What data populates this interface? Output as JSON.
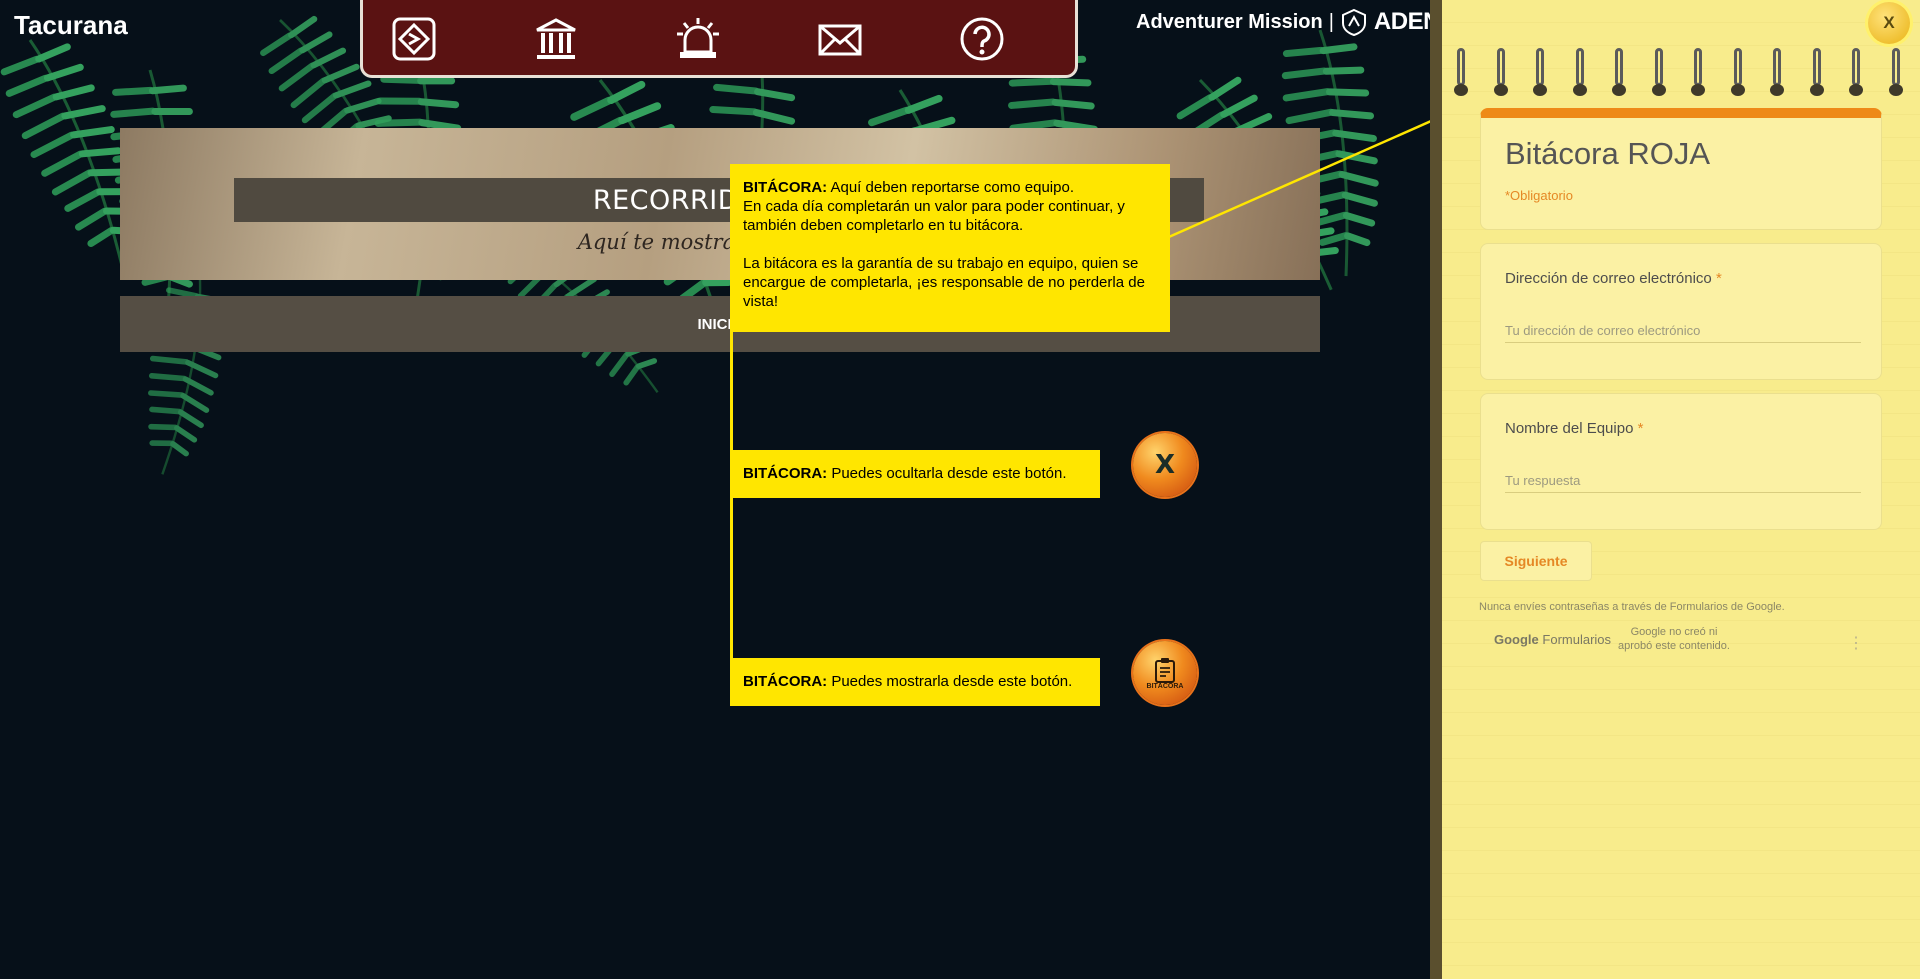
{
  "app": {
    "title": "Tacurana"
  },
  "toolbar": {
    "buttons": [
      {
        "name": "map-button",
        "icon": "map-pin-icon"
      },
      {
        "name": "museum-button",
        "icon": "museum-icon"
      },
      {
        "name": "alert-button",
        "icon": "siren-icon"
      },
      {
        "name": "mail-button",
        "icon": "envelope-icon"
      },
      {
        "name": "help-button",
        "icon": "question-icon"
      }
    ]
  },
  "brand": {
    "text": "Adventurer Mission",
    "separator": "|",
    "logo_text": "ADEN"
  },
  "banner": {
    "title": "RECORRIDO POR I",
    "subtitle": "Aquí te mostramos cómo u",
    "start_label": "INICIA"
  },
  "tooltips": {
    "main_heading": "BITÁCORA:",
    "main_line1": " Aquí deben reportarse como equipo.",
    "main_line2": "En cada día completarán un valor para poder continuar, y también deben completarlo en tu bitácora.",
    "main_line3": "La bitácora es la garantía de su trabajo en equipo, quien se encargue de completarla, ¡es responsable de no perderla de vista!",
    "hide_heading": "BITÁCORA:",
    "hide_text": " Puedes ocultarla desde este botón.",
    "show_heading": "BITÁCORA:",
    "show_text": " Puedes mostrarla desde este botón."
  },
  "round_buttons": {
    "hide_label": "X",
    "show_label": "BITÁCORA"
  },
  "notebook": {
    "close_label": "X",
    "form": {
      "title": "Bitácora ROJA",
      "required_note": "*Obligatorio",
      "email_label": "Dirección de correo electrónico",
      "email_placeholder": "Tu dirección de correo electrónico",
      "team_label": "Nombre del Equipo",
      "team_placeholder": "Tu respuesta",
      "required_star": "*",
      "next_label": "Siguiente",
      "password_note": "Nunca envíes contraseñas a través de Formularios de Google.",
      "google_logo": "Google",
      "forms_logo": "Formularios",
      "disclaimer": "Google no creó ni aprobó este contenido.",
      "menu_icon": "⋮"
    }
  },
  "colors": {
    "toolbar_bg": "#5a1212",
    "tooltip_bg": "#ffe600",
    "form_accent": "#ee8a17",
    "notebook_paper": "#f8ec8c"
  }
}
